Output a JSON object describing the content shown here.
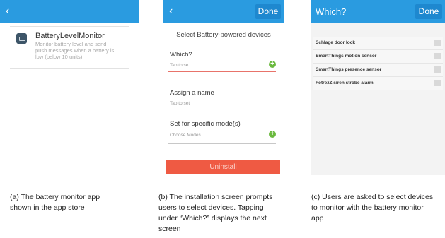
{
  "panel_a": {
    "back_icon": "chevron-left-icon",
    "app_name": "BatteryLevelMonitor",
    "app_description": "Monitor battery level and send push messages when a battery is low (below 10 units)"
  },
  "panel_b": {
    "back_icon": "chevron-left-icon",
    "done_label": "Done",
    "heading": "Select Battery-powered devices",
    "which_label": "Which?",
    "which_placeholder": "Tap to se",
    "name_label": "Assign a name",
    "name_placeholder": "Tap to set",
    "mode_label": "Set for specific mode(s)",
    "mode_placeholder": "Choose Modes",
    "uninstall_label": "Uninstall"
  },
  "panel_c": {
    "title": "Which?",
    "done_label": "Done",
    "devices": [
      "Schlage door lock",
      "SmartThings motion sensor",
      "SmartThings presence sensor",
      "FotrezZ siren strobe alarm"
    ]
  },
  "captions": {
    "a": [
      "(a)  The battery monitor app",
      "shown in the app store"
    ],
    "b": [
      "(b) The installation screen prompts",
      "users to select devices. Tapping",
      "under “Which?” displays the next",
      "screen"
    ],
    "c": [
      "(c)  Users are asked to select devices",
      "to monitor with the battery monitor",
      "app"
    ]
  },
  "colors": {
    "header_blue": "#2a9be0",
    "uninstall_red": "#ef5a43",
    "plus_green": "#6ab93e"
  }
}
